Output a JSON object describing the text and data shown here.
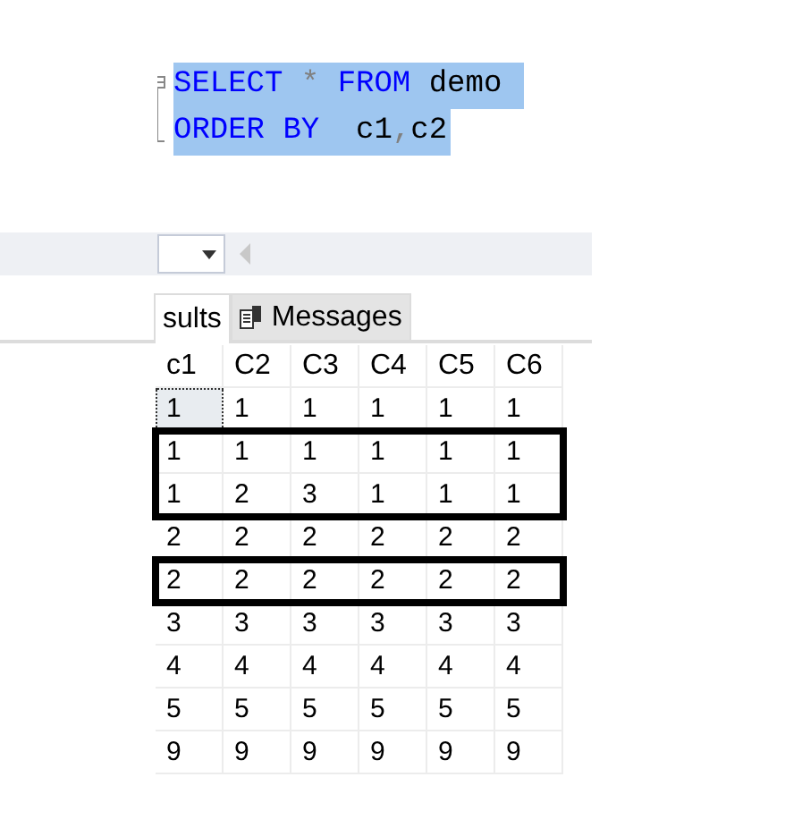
{
  "editor": {
    "lines": [
      {
        "tokens": [
          {
            "kind": "keyword",
            "text": "SELECT"
          },
          {
            "kind": "operator",
            "text": "*"
          },
          {
            "kind": "keyword",
            "text": "FROM"
          },
          {
            "kind": "plain",
            "text": "demo"
          }
        ]
      },
      {
        "tokens": [
          {
            "kind": "keyword",
            "text": "ORDER BY"
          },
          {
            "kind": "plain",
            "text": " c1"
          },
          {
            "kind": "operator",
            "text": ","
          },
          {
            "kind": "plain",
            "text": "c2"
          }
        ]
      }
    ],
    "selected": true
  },
  "tabs": [
    {
      "label": "sults",
      "selected": true
    },
    {
      "label": "Messages",
      "selected": false
    }
  ],
  "table": {
    "columns": [
      "c1",
      "C2",
      "C3",
      "C4",
      "C5",
      "C6"
    ],
    "rows": [
      {
        "cells": [
          "1",
          "1",
          "1",
          "1",
          "1",
          "1"
        ],
        "focused": true,
        "outlined": false
      },
      {
        "cells": [
          "1",
          "1",
          "1",
          "1",
          "1",
          "1"
        ],
        "focused": false,
        "outlined": true
      },
      {
        "cells": [
          "1",
          "2",
          "3",
          "1",
          "1",
          "1"
        ],
        "focused": false,
        "outlined": true
      },
      {
        "cells": [
          "2",
          "2",
          "2",
          "2",
          "2",
          "2"
        ],
        "focused": false,
        "outlined": false
      },
      {
        "cells": [
          "2",
          "2",
          "2",
          "2",
          "2",
          "2"
        ],
        "focused": false,
        "outlined": true
      },
      {
        "cells": [
          "3",
          "3",
          "3",
          "3",
          "3",
          "3"
        ],
        "focused": false,
        "outlined": false
      },
      {
        "cells": [
          "4",
          "4",
          "4",
          "4",
          "4",
          "4"
        ],
        "focused": false,
        "outlined": false
      },
      {
        "cells": [
          "5",
          "5",
          "5",
          "5",
          "5",
          "5"
        ],
        "focused": false,
        "outlined": false
      },
      {
        "cells": [
          "9",
          "9",
          "9",
          "9",
          "9",
          "9"
        ],
        "focused": false,
        "outlined": false
      }
    ]
  }
}
